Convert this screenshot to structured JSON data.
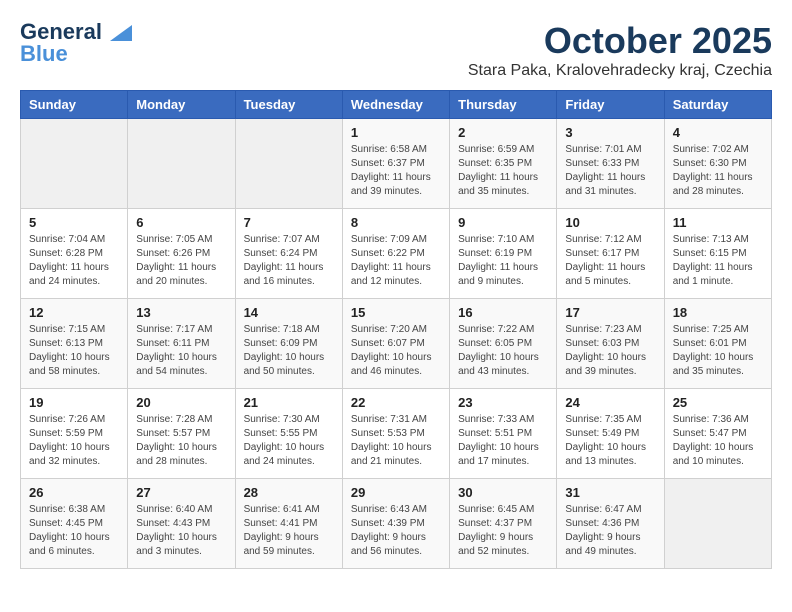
{
  "logo": {
    "line1": "General",
    "line2": "Blue"
  },
  "title": "October 2025",
  "location": "Stara Paka, Kralovehradecky kraj, Czechia",
  "days_of_week": [
    "Sunday",
    "Monday",
    "Tuesday",
    "Wednesday",
    "Thursday",
    "Friday",
    "Saturday"
  ],
  "weeks": [
    [
      {
        "day": "",
        "info": ""
      },
      {
        "day": "",
        "info": ""
      },
      {
        "day": "",
        "info": ""
      },
      {
        "day": "1",
        "info": "Sunrise: 6:58 AM\nSunset: 6:37 PM\nDaylight: 11 hours\nand 39 minutes."
      },
      {
        "day": "2",
        "info": "Sunrise: 6:59 AM\nSunset: 6:35 PM\nDaylight: 11 hours\nand 35 minutes."
      },
      {
        "day": "3",
        "info": "Sunrise: 7:01 AM\nSunset: 6:33 PM\nDaylight: 11 hours\nand 31 minutes."
      },
      {
        "day": "4",
        "info": "Sunrise: 7:02 AM\nSunset: 6:30 PM\nDaylight: 11 hours\nand 28 minutes."
      }
    ],
    [
      {
        "day": "5",
        "info": "Sunrise: 7:04 AM\nSunset: 6:28 PM\nDaylight: 11 hours\nand 24 minutes."
      },
      {
        "day": "6",
        "info": "Sunrise: 7:05 AM\nSunset: 6:26 PM\nDaylight: 11 hours\nand 20 minutes."
      },
      {
        "day": "7",
        "info": "Sunrise: 7:07 AM\nSunset: 6:24 PM\nDaylight: 11 hours\nand 16 minutes."
      },
      {
        "day": "8",
        "info": "Sunrise: 7:09 AM\nSunset: 6:22 PM\nDaylight: 11 hours\nand 12 minutes."
      },
      {
        "day": "9",
        "info": "Sunrise: 7:10 AM\nSunset: 6:19 PM\nDaylight: 11 hours\nand 9 minutes."
      },
      {
        "day": "10",
        "info": "Sunrise: 7:12 AM\nSunset: 6:17 PM\nDaylight: 11 hours\nand 5 minutes."
      },
      {
        "day": "11",
        "info": "Sunrise: 7:13 AM\nSunset: 6:15 PM\nDaylight: 11 hours\nand 1 minute."
      }
    ],
    [
      {
        "day": "12",
        "info": "Sunrise: 7:15 AM\nSunset: 6:13 PM\nDaylight: 10 hours\nand 58 minutes."
      },
      {
        "day": "13",
        "info": "Sunrise: 7:17 AM\nSunset: 6:11 PM\nDaylight: 10 hours\nand 54 minutes."
      },
      {
        "day": "14",
        "info": "Sunrise: 7:18 AM\nSunset: 6:09 PM\nDaylight: 10 hours\nand 50 minutes."
      },
      {
        "day": "15",
        "info": "Sunrise: 7:20 AM\nSunset: 6:07 PM\nDaylight: 10 hours\nand 46 minutes."
      },
      {
        "day": "16",
        "info": "Sunrise: 7:22 AM\nSunset: 6:05 PM\nDaylight: 10 hours\nand 43 minutes."
      },
      {
        "day": "17",
        "info": "Sunrise: 7:23 AM\nSunset: 6:03 PM\nDaylight: 10 hours\nand 39 minutes."
      },
      {
        "day": "18",
        "info": "Sunrise: 7:25 AM\nSunset: 6:01 PM\nDaylight: 10 hours\nand 35 minutes."
      }
    ],
    [
      {
        "day": "19",
        "info": "Sunrise: 7:26 AM\nSunset: 5:59 PM\nDaylight: 10 hours\nand 32 minutes."
      },
      {
        "day": "20",
        "info": "Sunrise: 7:28 AM\nSunset: 5:57 PM\nDaylight: 10 hours\nand 28 minutes."
      },
      {
        "day": "21",
        "info": "Sunrise: 7:30 AM\nSunset: 5:55 PM\nDaylight: 10 hours\nand 24 minutes."
      },
      {
        "day": "22",
        "info": "Sunrise: 7:31 AM\nSunset: 5:53 PM\nDaylight: 10 hours\nand 21 minutes."
      },
      {
        "day": "23",
        "info": "Sunrise: 7:33 AM\nSunset: 5:51 PM\nDaylight: 10 hours\nand 17 minutes."
      },
      {
        "day": "24",
        "info": "Sunrise: 7:35 AM\nSunset: 5:49 PM\nDaylight: 10 hours\nand 13 minutes."
      },
      {
        "day": "25",
        "info": "Sunrise: 7:36 AM\nSunset: 5:47 PM\nDaylight: 10 hours\nand 10 minutes."
      }
    ],
    [
      {
        "day": "26",
        "info": "Sunrise: 6:38 AM\nSunset: 4:45 PM\nDaylight: 10 hours\nand 6 minutes."
      },
      {
        "day": "27",
        "info": "Sunrise: 6:40 AM\nSunset: 4:43 PM\nDaylight: 10 hours\nand 3 minutes."
      },
      {
        "day": "28",
        "info": "Sunrise: 6:41 AM\nSunset: 4:41 PM\nDaylight: 9 hours\nand 59 minutes."
      },
      {
        "day": "29",
        "info": "Sunrise: 6:43 AM\nSunset: 4:39 PM\nDaylight: 9 hours\nand 56 minutes."
      },
      {
        "day": "30",
        "info": "Sunrise: 6:45 AM\nSunset: 4:37 PM\nDaylight: 9 hours\nand 52 minutes."
      },
      {
        "day": "31",
        "info": "Sunrise: 6:47 AM\nSunset: 4:36 PM\nDaylight: 9 hours\nand 49 minutes."
      },
      {
        "day": "",
        "info": ""
      }
    ]
  ]
}
